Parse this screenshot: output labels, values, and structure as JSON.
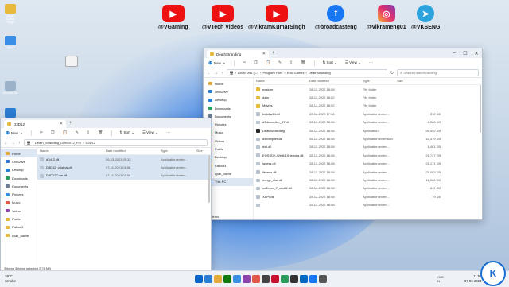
{
  "social": [
    {
      "icon": "youtube-icon",
      "handle": "@VGaming",
      "glyph": "▶",
      "cls": "yt"
    },
    {
      "icon": "youtube-icon",
      "handle": "@VTech Videos",
      "glyph": "▶",
      "cls": "yt"
    },
    {
      "icon": "youtube-icon",
      "handle": "@VikramKumarSingh",
      "glyph": "▶",
      "cls": "yt"
    },
    {
      "icon": "facebook-icon",
      "handle": "@broadcasteng",
      "glyph": "f",
      "cls": "fb"
    },
    {
      "icon": "instagram-icon",
      "handle": "@vikrameng01",
      "glyph": "◎",
      "cls": "ig"
    },
    {
      "icon": "telegram-icon",
      "handle": "@VKSENG",
      "glyph": "➤",
      "cls": "tg"
    }
  ],
  "desktop_icons": [
    "Vikram Kumar Singh",
    "This PC",
    "Recycle Bin",
    "Control Panel"
  ],
  "left_window": {
    "tab_title": "D3D12",
    "new_label": "New",
    "sort_label": "Sort",
    "view_label": "View",
    "breadcrumb": [
      "Death_Stranding_DirectX12_FIX",
      "D3D12"
    ],
    "search_placeholder": "Search D3D12",
    "columns": [
      "Name",
      "Date modified",
      "Type",
      "Size"
    ],
    "nav": [
      {
        "label": "Home",
        "sel": true,
        "color": "#e7a93c"
      },
      {
        "label": "OneDrive",
        "sel": false,
        "color": "#2b7cd3"
      },
      {
        "label": "Desktop",
        "sel": false,
        "color": "#2b7cd3"
      },
      {
        "label": "Downloads",
        "sel": false,
        "color": "#2a9d5c"
      },
      {
        "label": "Documents",
        "sel": false,
        "color": "#6b7c93"
      },
      {
        "label": "Pictures",
        "sel": false,
        "color": "#3a8ee6"
      },
      {
        "label": "Music",
        "sel": false,
        "color": "#e05a47"
      },
      {
        "label": "Videos",
        "sel": false,
        "color": "#8e44ad"
      },
      {
        "label": "Public",
        "sel": false,
        "color": "#e7b93c"
      },
      {
        "label": "Fallout3",
        "sel": false,
        "color": "#e7b93c"
      },
      {
        "label": "cyak_cache",
        "sel": false,
        "color": "#e7b93c"
      }
    ],
    "rows": [
      {
        "name": "d3d12.dll",
        "date": "06-03-2023 05:34",
        "type": "Application exten...",
        "size": ""
      },
      {
        "name": "D3D12_original.dll",
        "date": "07-11-2021 01:56",
        "type": "Application exten...",
        "size": ""
      },
      {
        "name": "D3D12Core.dll",
        "date": "07-11-2021 01:56",
        "type": "Application exten...",
        "size": ""
      }
    ],
    "status": "3 items   3 items selected  2.78 MB"
  },
  "right_window": {
    "tab_title": "DeathStranding",
    "new_label": "New",
    "sort_label": "Sort",
    "view_label": "View",
    "breadcrumb": [
      "Local Disk (C:)",
      "Program Files",
      "Epic Games",
      "DeathStranding"
    ],
    "search_placeholder": "Search DeathStranding",
    "columns": [
      "Name",
      "Date modified",
      "Type",
      "Size"
    ],
    "nav": [
      {
        "label": "Home",
        "sel": false,
        "color": "#e7a93c"
      },
      {
        "label": "OneDrive",
        "sel": false,
        "color": "#2b7cd3"
      },
      {
        "label": "Desktop",
        "sel": false,
        "color": "#2b7cd3"
      },
      {
        "label": "Downloads",
        "sel": false,
        "color": "#2a9d5c"
      },
      {
        "label": "Documents",
        "sel": false,
        "color": "#6b7c93"
      },
      {
        "label": "Pictures",
        "sel": false,
        "color": "#3a8ee6"
      },
      {
        "label": "Music",
        "sel": false,
        "color": "#e05a47"
      },
      {
        "label": "Videos",
        "sel": false,
        "color": "#8e44ad"
      },
      {
        "label": "Public",
        "sel": false,
        "color": "#e7b93c"
      },
      {
        "label": "Desktop",
        "sel": false,
        "color": "#2b7cd3"
      },
      {
        "label": "Fallout3",
        "sel": false,
        "color": "#e7b93c"
      },
      {
        "label": "cyak_cache",
        "sel": false,
        "color": "#e7b93c"
      },
      {
        "label": "This PC",
        "sel": true,
        "color": "#3a8ee6"
      }
    ],
    "rows": [
      {
        "name": "egstore",
        "date": "28-12-2022 18:08",
        "type": "File folder",
        "size": "",
        "kind": "folder"
      },
      {
        "name": "data",
        "date": "28-12-2022 18:02",
        "type": "File folder",
        "size": "",
        "kind": "folder"
      },
      {
        "name": "Movies",
        "date": "28-12-2022 18:02",
        "type": "File folder",
        "size": "",
        "kind": "folder"
      },
      {
        "name": "bink2w64.dll",
        "date": "28-12-2022 17:38",
        "type": "Application exten...",
        "size": "372 KB",
        "kind": "dll"
      },
      {
        "name": "d3dcompiler_47.dll",
        "date": "28-12-2022 18:06",
        "type": "Application exten...",
        "size": "4,586 KB",
        "kind": "dll"
      },
      {
        "name": "DeathStranding",
        "date": "28-12-2022 18:08",
        "type": "Application",
        "size": "94,492 KB",
        "kind": "app"
      },
      {
        "name": "dxcompiler.dll",
        "date": "28-12-2022 18:08",
        "type": "Application extension",
        "size": "16,379 KB",
        "kind": "dll"
      },
      {
        "name": "dxil.dll",
        "date": "28-12-2022 18:08",
        "type": "Application exten...",
        "size": "1,461 KB",
        "kind": "dll"
      },
      {
        "name": "EOSSDK-Win64-Shipping.dll",
        "date": "28-12-2022 18:08",
        "type": "Application exten...",
        "size": "21,747 KB",
        "kind": "dll"
      },
      {
        "name": "igxess.dll",
        "date": "28-12-2022 18:08",
        "type": "Application exten...",
        "size": "21,171 KB",
        "kind": "dll"
      },
      {
        "name": "libxess.dll",
        "date": "28-12-2022 18:08",
        "type": "Application exten...",
        "size": "21,083 KB",
        "kind": "dll"
      },
      {
        "name": "nvngx_dlss.dll",
        "date": "28-12-2022 18:08",
        "type": "Application exten...",
        "size": "11,566 KB",
        "kind": "dll"
      },
      {
        "name": "oo2core_7_win64.dll",
        "date": "28-12-2022 18:08",
        "type": "Application exten...",
        "size": "842 KB",
        "kind": "dll"
      },
      {
        "name": "XAPI.dll",
        "date": "28-12-2022 18:08",
        "type": "Application exten...",
        "size": "79 KB",
        "kind": "dll"
      },
      {
        "name": "",
        "date": "28-12-2022 18:08",
        "type": "Application exten...",
        "size": "",
        "kind": "dll"
      }
    ],
    "status": "15 items"
  },
  "taskbar": {
    "weather_temp": "38°C",
    "weather_desc": "Smoke",
    "lang": "ENG\nIN",
    "time": "11:52",
    "date": "07-06-2023",
    "icons": [
      "#0a64c8",
      "#2b7cd3",
      "#e7a93c",
      "#0f7b0f",
      "#3a8ee6",
      "#8e44ad",
      "#e05a47",
      "#444",
      "#c8102e",
      "#2a9d5c",
      "#333",
      "#0067c0",
      "#1877f2",
      "#555"
    ]
  },
  "logo_text": "K"
}
